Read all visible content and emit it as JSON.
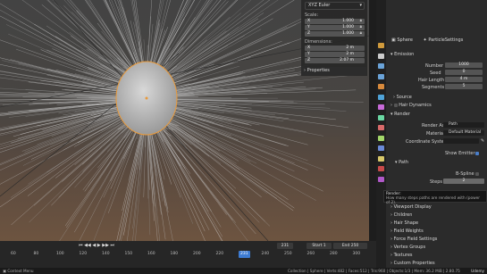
{
  "viewport": {
    "label": "",
    "panel": {
      "dropdown": "XYZ Euler",
      "scale_heading": "Scale:",
      "scale": [
        {
          "axis": "X",
          "value": "1.000"
        },
        {
          "axis": "Y",
          "value": "1.000"
        },
        {
          "axis": "Z",
          "value": "1.000"
        }
      ],
      "dimensions_heading": "Dimensions:",
      "dimensions": [
        {
          "axis": "X",
          "value": "2 m"
        },
        {
          "axis": "Y",
          "value": "2 m"
        },
        {
          "axis": "Z",
          "value": "2.07 m"
        }
      ],
      "properties_label": "Properties"
    }
  },
  "properties": {
    "header": {
      "object": "Sphere",
      "system": "ParticleSettings"
    },
    "emission": {
      "title": "Emission",
      "fields": [
        {
          "label": "Number",
          "value": "1000"
        },
        {
          "label": "Seed",
          "value": "0"
        },
        {
          "label": "Hair Length",
          "value": "4 m"
        },
        {
          "label": "Segments",
          "value": "5"
        }
      ]
    },
    "source_title": "Source",
    "hair_dynamics_title": "Hair Dynamics",
    "render": {
      "title": "Render",
      "render_as_label": "Render As",
      "render_as_value": "Path",
      "material_label": "Material",
      "material_value": "Default Material",
      "coord_label": "Coordinate System",
      "show_emitter_label": "Show Emitter"
    },
    "path": {
      "title": "Path",
      "bspline_label": "B-Spline",
      "steps_label": "Steps",
      "steps_value": "2"
    },
    "tooltip": {
      "title": "Render:",
      "desc": "How many steps paths are rendered with (power of 2)."
    },
    "collapsed": [
      "Viewport Display",
      "Children",
      "Hair Shape",
      "Field Weights",
      "Force Field Settings",
      "Vertex Groups",
      "Textures",
      "Custom Properties"
    ],
    "tab_colors": [
      "#d09a3c",
      "#cccccc",
      "#6aa3d8",
      "#6aa3d8",
      "#d88a3c",
      "#4fa3d8",
      "#c86ad8",
      "#6ad8a3",
      "#d86a6a",
      "#a3d86a",
      "#6a8ad8",
      "#d8c86a",
      "#c84a4a",
      "#b058c8"
    ]
  },
  "timeline": {
    "current_frame": "231",
    "start_label": "Start",
    "start_value": "1",
    "end_label": "End",
    "end_value": "250",
    "ruler": [
      "60",
      "80",
      "100",
      "120",
      "140",
      "150",
      "160",
      "180",
      "200",
      "220",
      "231",
      "240",
      "250",
      "260",
      "280",
      "300"
    ]
  },
  "statusbar": {
    "left": "Context Menu",
    "right": "Collection | Sphere | Verts:482 | Faces:512 | Tris:960 | Objects:1/3 | Mem: 36.2 MiB | 2.80.75",
    "brand": "Udemy"
  }
}
